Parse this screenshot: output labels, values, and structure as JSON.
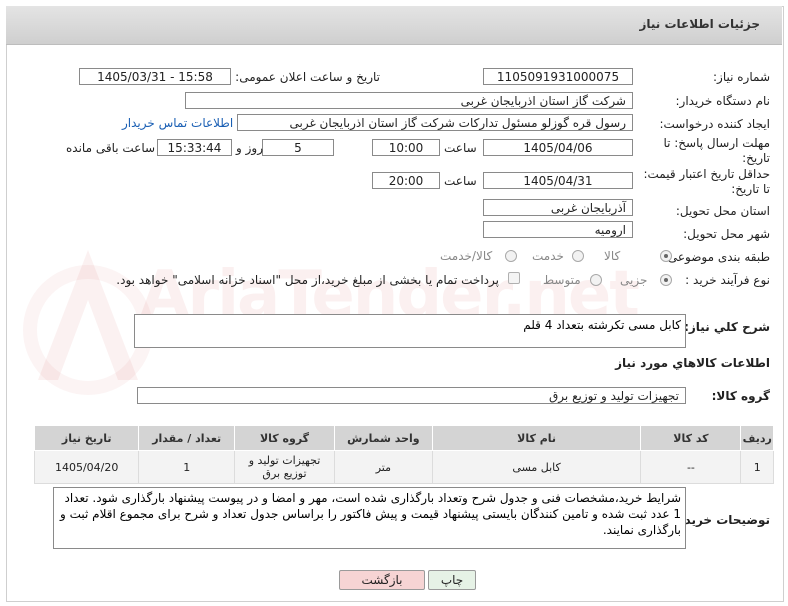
{
  "header": {
    "title": "جزئیات اطلاعات نیاز"
  },
  "fields": {
    "need_number_label": "شماره نیاز:",
    "need_number": "1105091931000075",
    "announce_label": "تاریخ و ساعت اعلان عمومی:",
    "announce_value": "1405/03/31 - 15:58",
    "buyer_org_label": "نام دستگاه خریدار:",
    "buyer_org": "شرکت گاز استان اذربایجان غربی",
    "creator_label": "ایجاد کننده درخواست:",
    "creator": "رسول قره گوزلو مسئول تدارکات شرکت گاز استان اذربایجان غربی",
    "contact_link": "اطلاعات تماس خریدار",
    "deadline_label_line1": "مهلت ارسال پاسخ: تا",
    "deadline_label_line2": "تاریخ:",
    "deadline_date": "1405/04/06",
    "time_label": "ساعت",
    "deadline_time": "10:00",
    "days_value": "5",
    "days_label": "روز و",
    "remaining_time": "15:33:44",
    "remaining_label": "ساعت باقی مانده",
    "price_label_line1": "حداقل تاریخ اعتبار قیمت:",
    "price_label_line2": "تا تاریخ:",
    "price_date": "1405/04/31",
    "price_time_label": "ساعت",
    "price_time": "20:00",
    "province_label": "استان محل تحویل:",
    "province": "آذربایجان غربی",
    "city_label": "شهر محل تحویل:",
    "city": "ارومیه",
    "category_label": "طبقه بندی موضوعی:",
    "category_options": [
      "کالا",
      "خدمت",
      "کالا/خدمت"
    ],
    "process_label": "نوع فرآیند خرید :",
    "process_options": [
      "جزیی",
      "متوسط"
    ],
    "payment_note": "پرداخت تمام یا بخشی از مبلغ خرید،از محل \"اسناد خزانه اسلامی\" خواهد بود."
  },
  "description": {
    "label": "شرح کلي نياز:",
    "text": "کابل مسی تکرشته بتعداد 4 قلم"
  },
  "goods_section": {
    "title": "اطلاعات کالاهاي مورد نياز",
    "group_label": "گروه کالا:",
    "group_value": "تجهیزات تولید و توزیع برق"
  },
  "table": {
    "columns": [
      "ردیف",
      "کد کالا",
      "نام کالا",
      "واحد شمارش",
      "گروه کالا",
      "تعداد / مقدار",
      "تاریخ نیاز"
    ],
    "rows": [
      [
        "1",
        "--",
        "کابل مسی",
        "متر",
        "تجهیزات تولید و توزیع برق",
        "1",
        "1405/04/20"
      ]
    ]
  },
  "buyer_notes": {
    "label": "توضیحات خریدار:",
    "text": "شرایط خرید،مشخصات فنی و جدول شرح وتعداد بارگذاری شده است، مهر و امضا و در پیوست پیشنهاد بارگذاری شود. تعداد 1 عدد ثبت شده و تامین کنندگان بایستی پیشنهاد قیمت و پیش فاکتور را براساس جدول تعداد و شرح برای مجموع اقلام ثبت و بارگذاری نمایند."
  },
  "buttons": {
    "print": "چاپ",
    "back": "بازگشت"
  },
  "watermark": "AriaTender.net",
  "colors": {
    "link": "#1a5fb4",
    "back_button": "#f6d4d4",
    "print_button": "#e6f2e6"
  }
}
